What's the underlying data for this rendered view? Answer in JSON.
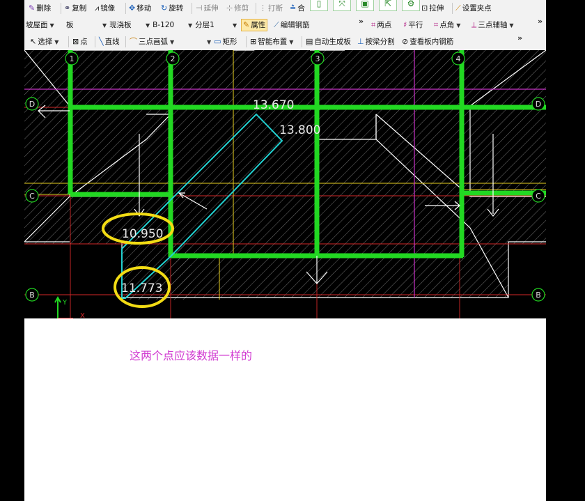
{
  "toolbar1": {
    "delete": "删除",
    "copy": "复制",
    "mirror": "镜像",
    "move": "移动",
    "rotate": "旋转",
    "extend": "延伸",
    "trim": "修剪",
    "break": "打断",
    "merge": "合",
    "stretch": "拉伸",
    "set_grip": "设置夹点"
  },
  "toolbar2": {
    "floor": "坡屋面",
    "category": "板",
    "slab_type": "现浇板",
    "spec": "B-120",
    "layer": "分层1",
    "properties": "属性",
    "edit_rebar": "编辑钢筋",
    "two_points": "两点",
    "parallel": "平行",
    "point_angle": "点角",
    "three_point_axis": "三点辅轴"
  },
  "toolbar3": {
    "select": "选择",
    "point": "点",
    "line": "直线",
    "arc": "三点画弧",
    "rect": "矩形",
    "smart_layout": "智能布置",
    "auto_slab": "自动生成板",
    "split_by_beam": "按梁分割",
    "view_rebar": "查看板内钢筋"
  },
  "drawing": {
    "axis_labels": {
      "c1": "1",
      "c2": "2",
      "c3": "3",
      "c4": "4",
      "rD": "D",
      "rC": "C",
      "rB": "B"
    },
    "elev_1": "13.670",
    "elev_2": "13.800",
    "elev_3": "10.950",
    "elev_4": "11.773",
    "y_axis": "Y",
    "x_axis": "X"
  },
  "annotation": "这两个点应该数据一样的",
  "colors": {
    "beam": "#22d822",
    "highlight": "#22d0d0",
    "circle": "#f2dc14",
    "note": "#d13ad1"
  }
}
